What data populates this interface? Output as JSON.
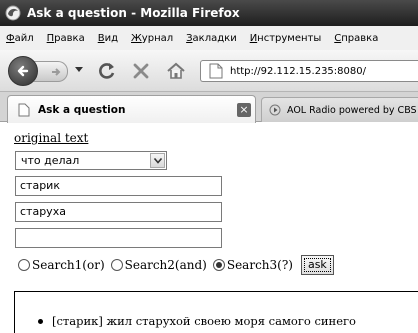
{
  "window": {
    "title": "Ask a question - Mozilla Firefox"
  },
  "menu": {
    "items": [
      {
        "u": "Ф",
        "rest": "айл"
      },
      {
        "u": "П",
        "rest": "равка"
      },
      {
        "u": "В",
        "rest": "ид"
      },
      {
        "u": "Ж",
        "rest": "урнал"
      },
      {
        "u": "З",
        "rest": "акладки"
      },
      {
        "u": "И",
        "rest": "нструменты"
      },
      {
        "u": "С",
        "rest": "правка"
      }
    ]
  },
  "nav": {
    "url": "http://92.112.15.235:8080/"
  },
  "tabs": [
    {
      "label": "Ask a question",
      "active": true
    },
    {
      "label": "AOL Radio powered by CBS",
      "active": false
    }
  ],
  "page": {
    "link": "original text",
    "select": {
      "value": "что делал"
    },
    "fields": [
      "старик",
      "старуха",
      ""
    ],
    "radios": [
      {
        "label": "Search1(or)",
        "checked": false
      },
      {
        "label": "Search2(and)",
        "checked": false
      },
      {
        "label": "Search3(?)",
        "checked": true
      }
    ],
    "ask_button": "ask",
    "results": [
      "[старик] жил старухой своею моря самого синего"
    ]
  },
  "colors": {
    "titlebar": "#2b2b2b",
    "menubar": "#f0f0f0",
    "tabbar": "#d4d4d4"
  },
  "icons": [
    "firefox-icon",
    "back-arrow-icon",
    "forward-arrow-icon",
    "reload-icon",
    "stop-icon",
    "home-icon",
    "page-icon",
    "close-icon",
    "radio-icon",
    "chevron-down-icon"
  ]
}
